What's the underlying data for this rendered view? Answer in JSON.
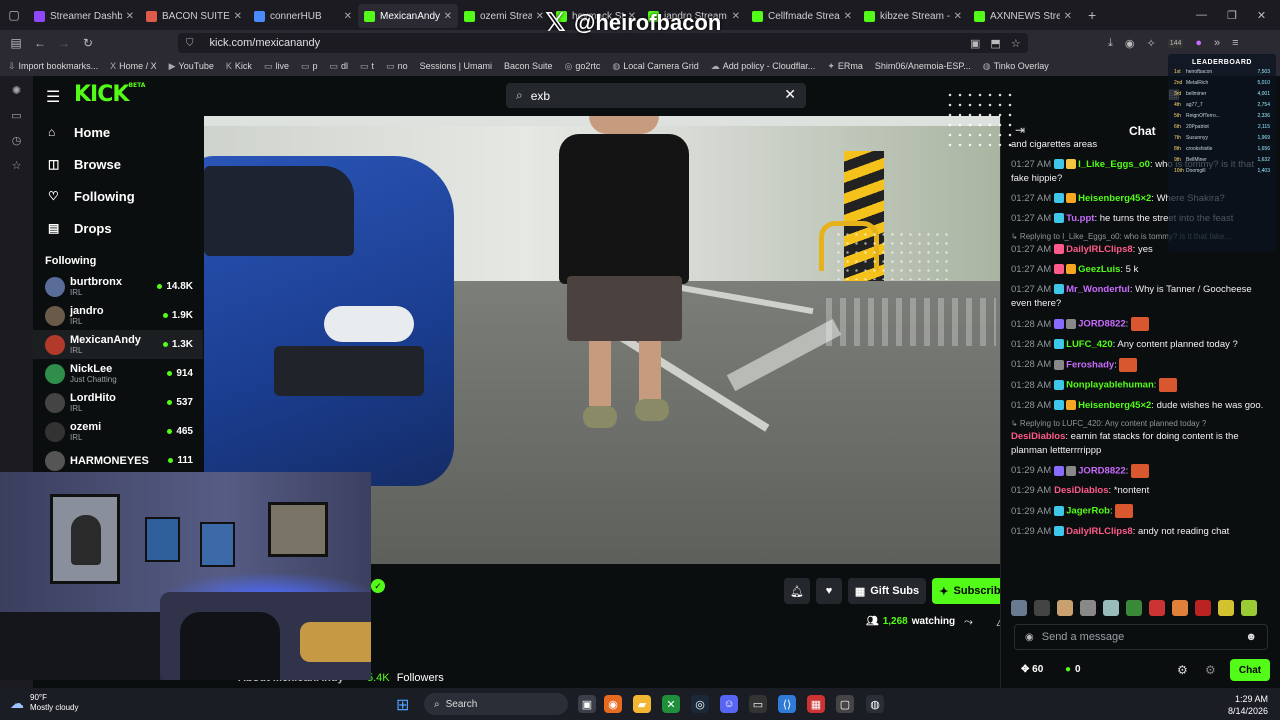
{
  "browser": {
    "tabs": [
      {
        "title": "Streamer Dashboard | Tw",
        "color": "#9147ff",
        "active": false
      },
      {
        "title": "BACON SUITE V4 //",
        "color": "#e05a4a",
        "active": false
      },
      {
        "title": "connerHUB",
        "color": "#4a8cff",
        "active": false
      },
      {
        "title": "MexicanAndy St",
        "color": "#53fc18",
        "active": true
      },
      {
        "title": "ozemi Strea",
        "color": "#53fc18",
        "active": false
      },
      {
        "title": "heymack Stre",
        "color": "#53fc18",
        "active": false
      },
      {
        "title": "jandro Stream -",
        "color": "#53fc18",
        "active": false
      },
      {
        "title": "Cellfmade Stream - Ki",
        "color": "#53fc18",
        "active": false
      },
      {
        "title": "kibzee Stream - Wat",
        "color": "#53fc18",
        "active": false
      },
      {
        "title": "AXNNEWS Stream -",
        "color": "#53fc18",
        "active": false
      }
    ],
    "url": "kick.com/mexicanandy",
    "badge_count": "144",
    "bookmarks": [
      {
        "icon": "⇩",
        "label": "Import bookmarks..."
      },
      {
        "icon": "X",
        "label": "Home / X"
      },
      {
        "icon": "▶",
        "label": "YouTube"
      },
      {
        "icon": "K",
        "label": "Kick"
      },
      {
        "icon": "▭",
        "label": "live"
      },
      {
        "icon": "▭",
        "label": "p"
      },
      {
        "icon": "▭",
        "label": "dl"
      },
      {
        "icon": "▭",
        "label": "t"
      },
      {
        "icon": "▭",
        "label": "no"
      },
      {
        "icon": "",
        "label": "Sessions | Umami"
      },
      {
        "icon": "",
        "label": "Bacon Suite"
      },
      {
        "icon": "◎",
        "label": "go2rtc"
      },
      {
        "icon": "◍",
        "label": "Local Camera Grid"
      },
      {
        "icon": "☁",
        "label": "Add policy - Cloudflar..."
      },
      {
        "icon": "✦",
        "label": "ERma"
      },
      {
        "icon": "",
        "label": "Shim06/Anemoia-ESP..."
      },
      {
        "icon": "◍",
        "label": "Tinko Overlay"
      }
    ]
  },
  "kick": {
    "logo": "KICK",
    "logo_badge": "BETA",
    "search_value": "exb",
    "nav": [
      {
        "icon": "⌂",
        "label": "Home",
        "name": "nav-home"
      },
      {
        "icon": "◫",
        "label": "Browse",
        "name": "nav-browse"
      },
      {
        "icon": "♡",
        "label": "Following",
        "name": "nav-following"
      },
      {
        "icon": "▤",
        "label": "Drops",
        "name": "nav-drops"
      }
    ],
    "following_header": "Following",
    "following": [
      {
        "name": "burtbronx",
        "category": "IRL",
        "viewers": "14.8K",
        "color": "#5a6c9a"
      },
      {
        "name": "jandro",
        "category": "IRL",
        "viewers": "1.9K",
        "color": "#6a5a4a"
      },
      {
        "name": "MexicanAndy",
        "category": "IRL",
        "viewers": "1.3K",
        "color": "#b23a2a",
        "selected": true
      },
      {
        "name": "NickLee",
        "category": "Just Chatting",
        "viewers": "914",
        "color": "#2f8f4a"
      },
      {
        "name": "LordHito",
        "category": "IRL",
        "viewers": "537",
        "color": "#444"
      },
      {
        "name": "ozemi",
        "category": "IRL",
        "viewers": "465",
        "color": "#333"
      },
      {
        "name": "HARMONEYES",
        "category": "",
        "viewers": "111",
        "color": "#555"
      }
    ],
    "actions": {
      "gift_subs": "Gift Subs",
      "subscribe": "Subscribe",
      "watching_count": "1,268",
      "watching_label": "watching"
    },
    "about": "About MexicanAndy",
    "followers_count": "5.4K",
    "followers_label": "Followers"
  },
  "chat": {
    "title": "Chat",
    "messages": [
      {
        "time": "",
        "user": "",
        "user_color": "#fff",
        "text": "and cigarettes areas",
        "badges": []
      },
      {
        "time": "01:27 AM",
        "user": "I_Like_Eggs_o0",
        "user_color": "#53fc18",
        "text": "who is tommy? is it that fake hippie?",
        "badges": [
          "#3ec7e8",
          "#f5c542"
        ]
      },
      {
        "time": "01:27 AM",
        "user": "Heisenberg45×2",
        "user_color": "#53fc18",
        "text": "Where Shakira?",
        "badges": [
          "#3ec7e8",
          "#f5a623"
        ]
      },
      {
        "time": "01:27 AM",
        "user": "Tu.ppt",
        "user_color": "#c86bff",
        "text": "he turns the street into the feast",
        "badges": [
          "#3ec7e8"
        ]
      },
      {
        "reply": "Replying to I_Like_Eggs_o0: who is tommy? is it that fake..."
      },
      {
        "time": "01:27 AM",
        "user": "DailyIRLClips8",
        "user_color": "#ff5a8a",
        "text": "yes",
        "badges": [
          "#ff5a8a"
        ]
      },
      {
        "time": "01:27 AM",
        "user": "GeezLuis",
        "user_color": "#53fc18",
        "text": "5 k",
        "badges": [
          "#ff5a8a",
          "#f5a623"
        ]
      },
      {
        "time": "01:27 AM",
        "user": "Mr_Wonderful",
        "user_color": "#c86bff",
        "text": "Why is Tanner / Goocheese even there?",
        "badges": [
          "#3ec7e8"
        ]
      },
      {
        "time": "01:28 AM",
        "user": "JORD8822",
        "user_color": "#c86bff",
        "text": "",
        "badges": [
          "#8a6bff",
          "#888"
        ]
      },
      {
        "time": "01:28 AM",
        "user": "LUFC_420",
        "user_color": "#53fc18",
        "text": "Any content planned today ?",
        "badges": [
          "#3ec7e8"
        ]
      },
      {
        "time": "01:28 AM",
        "user": "Feroshady",
        "user_color": "#c86bff",
        "text": "",
        "badges": [
          "#888"
        ]
      },
      {
        "time": "01:28 AM",
        "user": "Nonplayablehuman",
        "user_color": "#53fc18",
        "text": "",
        "badges": [
          "#3ec7e8"
        ]
      },
      {
        "time": "01:28 AM",
        "user": "Heisenberg45×2",
        "user_color": "#53fc18",
        "text": "dude wishes he was goo.",
        "badges": [
          "#3ec7e8",
          "#f5a623"
        ]
      },
      {
        "reply": "Replying to LUFC_420: Any content planned today ?"
      },
      {
        "time": "",
        "user": "DesiDiablos",
        "user_color": "#ff5a8a",
        "text": "earnin fat stacks for doing content is the planman lettterrrrippp",
        "badges": []
      },
      {
        "time": "01:29 AM",
        "user": "JORD8822",
        "user_color": "#c86bff",
        "text": "",
        "badges": [
          "#8a6bff",
          "#888"
        ]
      },
      {
        "time": "01:29 AM",
        "user": "DesiDiablos",
        "user_color": "#ff5a8a",
        "text": "*nontent",
        "badges": []
      },
      {
        "time": "01:29 AM",
        "user": "JagerRob",
        "user_color": "#53fc18",
        "text": "",
        "badges": [
          "#3ec7e8"
        ]
      },
      {
        "time": "01:29 AM",
        "user": "DailyIRLClips8",
        "user_color": "#ff5a8a",
        "text": "andy not reading chat",
        "badges": [
          "#3ec7e8"
        ]
      }
    ],
    "input_placeholder": "Send a message",
    "points": "60",
    "kicks": "0",
    "chat_button": "Chat"
  },
  "overlay": {
    "x_handle": "@heirofbacon",
    "leaderboard_title": "LEADERBOARD",
    "leaderboard": [
      {
        "pos": "1st",
        "name": "heirofbacon",
        "value": "7,503"
      },
      {
        "pos": "2nd",
        "name": "MetalRich",
        "value": "5,010"
      },
      {
        "pos": "3rd",
        "name": "bellminer",
        "value": "4,001"
      },
      {
        "pos": "4th",
        "name": "ag77_7",
        "value": "2,754"
      },
      {
        "pos": "5th",
        "name": "ReignOfTerro...",
        "value": "2,336"
      },
      {
        "pos": "6th",
        "name": "20Ppatriot",
        "value": "2,115"
      },
      {
        "pos": "7th",
        "name": "Susunnyy",
        "value": "1,969"
      },
      {
        "pos": "8th",
        "name": "crookshistle",
        "value": "1,656"
      },
      {
        "pos": "9th",
        "name": "BellMiner",
        "value": "1,632"
      },
      {
        "pos": "10th",
        "name": "Doomgill",
        "value": "1,403"
      }
    ]
  },
  "taskbar": {
    "temp": "90°F",
    "weather": "Mostly cloudy",
    "search": "Search",
    "time": "1:29 AM",
    "date": "8/14/2026"
  }
}
